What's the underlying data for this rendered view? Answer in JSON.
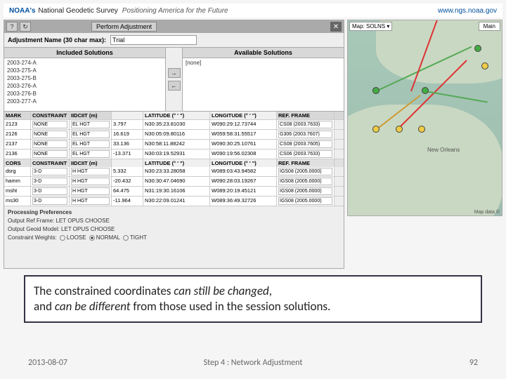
{
  "header": {
    "noaa": "NOAA's",
    "ngs": "National Geodetic Survey",
    "tagline": "Positioning America for the Future",
    "url": "www.ngs.noaa.gov"
  },
  "dialog": {
    "help_label": "?",
    "refresh_label": "↻",
    "perform_label": "Perform Adjustment",
    "close_label": "✕",
    "adj_name_label": "Adjustment Name (30 char max):",
    "adj_name_value": "Trial"
  },
  "panels": {
    "included_title": "Included Solutions",
    "available_title": "Available Solutions",
    "move_right": "→",
    "move_left": "←",
    "available_none": "[none]",
    "included": [
      "2003-274-A",
      "2003-275-A",
      "2003-275-B",
      "2003-276-A",
      "2003-276-B",
      "2003-277-A"
    ]
  },
  "marks": {
    "head": {
      "mark": "MARK",
      "constraint": "CONSTRAINT",
      "idcnt": "IIDCIIT (m)",
      "lat": "LATITUDE (° ' \")",
      "lon": "LONGITUDE (° ' \")",
      "ref": "REF. FRAME"
    },
    "rows": [
      {
        "mark": "2123",
        "cons": "NONE",
        "idcnt": "EL HGT",
        "val": "3.797",
        "lat": "N30:35:23.81030",
        "lon": "W090:29:12.73744",
        "ref": "CS08 (2003.7633)"
      },
      {
        "mark": "2126",
        "cons": "NONE",
        "idcnt": "EL HGT",
        "val": "16.619",
        "lat": "N30:05:09.80116",
        "lon": "W059:58:31.55517",
        "ref": "G306 (2003.7607)"
      },
      {
        "mark": "2137",
        "cons": "NONE",
        "idcnt": "EL HGT",
        "val": "33.136",
        "lat": "N30:58:11.88242",
        "lon": "W090:30:25.10761",
        "ref": "CS08 (2003.7605)"
      },
      {
        "mark": "2136",
        "cons": "NONE",
        "idcnt": "EL HGT",
        "val": "-13.371",
        "lat": "N30:03:19.52931",
        "lon": "W090:19:56.02308",
        "ref": "CS06 (2003.7633)"
      }
    ],
    "cors_head": {
      "mark": "CORS",
      "constraint": "CONSTRAINT",
      "idcnt": "IIDCIIT (m)",
      "lat": "LATITUDE (° ' \")",
      "lon": "LONGITUDE (° ' \")",
      "ref": "REF. FRAME"
    },
    "cors_rows": [
      {
        "mark": "dsrg",
        "cons": "3-D",
        "idcnt": "H HGT",
        "val": "5.332",
        "lat": "N30:23:33.28058",
        "lon": "W089:03:43.94582",
        "ref": "IGS08 (2005.0000)"
      },
      {
        "mark": "hamm",
        "cons": "3-D",
        "idcnt": "H HGT",
        "val": "-20.432",
        "lat": "N30:30:47.04690",
        "lon": "W090:28:03.19267",
        "ref": "IGS08 (2005.0000)"
      },
      {
        "mark": "msht",
        "cons": "3-D",
        "idcnt": "H HGT",
        "val": "64.475",
        "lat": "N31:19:30.16106",
        "lon": "W089:20:19.45121",
        "ref": "IGS08 (2005.0000)"
      },
      {
        "mark": "ms30",
        "cons": "3-D",
        "idcnt": "H HGT",
        "val": "-11.964",
        "lat": "N30:22:09.01241",
        "lon": "W089:36:49.32726",
        "ref": "IGS08 (2005.0000)"
      }
    ]
  },
  "prefs": {
    "title": "Processing Preferences",
    "l1": "Output Ref Frame:   LET OPUS CHOOSE",
    "l2": "Output Geoid Model:  LET OPUS CHOOSE",
    "l3_label": "Constraint Weights:",
    "opt_loose": "LOOSE",
    "opt_normal": "NORMAL",
    "opt_tight": "TIGHT"
  },
  "map": {
    "type_label": "Map: SOLNS ▾",
    "main_label": "Main",
    "credit": "Map data ©",
    "city": "New Orleans"
  },
  "callout": {
    "line1a": "The constrained coordinates ",
    "line1b": "can still be changed",
    "line1c": ",",
    "line2a": "and ",
    "line2b": "can be different",
    "line2c": " from those used in the session solutions."
  },
  "footer": {
    "date": "2013-08-07",
    "step": "Step 4 : Network Adjustment",
    "page": "92"
  }
}
